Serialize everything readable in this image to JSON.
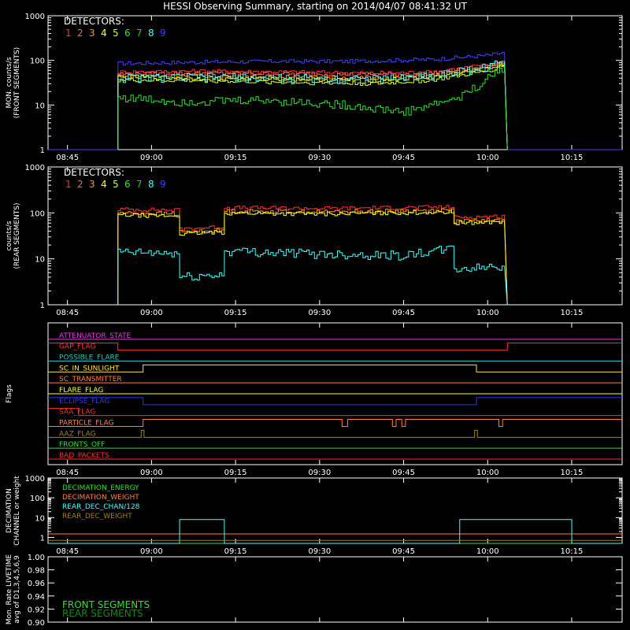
{
  "title": "HESSI Observing Summary, starting on 2014/04/07 08:41:32 UT",
  "colors": {
    "background": "#000000",
    "axes": "#ffffff",
    "det": [
      "#ff3030",
      "#ff6060",
      "#ff9020",
      "#ffff20",
      "#c8ff20",
      "#30e030",
      "#30c030",
      "#40ffff",
      "#4040ff"
    ]
  },
  "time_ticks": [
    "08:45",
    "09:00",
    "09:15",
    "09:30",
    "09:45",
    "10:00",
    "10:15"
  ],
  "chart_data": [
    {
      "id": "front",
      "type": "line",
      "ylabel": "MON. counts/s\n(FRONT SEGMENTS)",
      "yscale": "log",
      "ylim": [
        1,
        1000
      ],
      "ytick_labels": [
        "1",
        "10",
        "100",
        "1000"
      ],
      "xlim": [
        "08:41:32",
        "10:24:00"
      ],
      "legend_title": "DETECTORS:",
      "legend_numbers": [
        "1",
        "2",
        "3",
        "4",
        "5",
        "6",
        "7",
        "8",
        "9"
      ],
      "series": [
        {
          "det": 9,
          "x": [
            "08:41:32",
            "08:54:00",
            "08:54:01",
            "09:05",
            "09:20",
            "09:35",
            "09:50",
            "10:00",
            "10:03",
            "10:03:30",
            "10:24"
          ],
          "y": [
            1,
            1,
            85,
            90,
            95,
            95,
            105,
            130,
            150,
            1,
            1
          ]
        },
        {
          "det": 1,
          "x": [
            "08:54:00",
            "08:54:01",
            "09:10",
            "09:25",
            "09:40",
            "09:50",
            "10:00",
            "10:03",
            "10:03:30"
          ],
          "y": [
            1,
            55,
            58,
            55,
            52,
            55,
            80,
            100,
            1
          ]
        },
        {
          "det": 2,
          "x": [
            "08:54:00",
            "08:54:01",
            "09:10",
            "09:25",
            "09:40",
            "09:50",
            "10:00",
            "10:03",
            "10:03:30"
          ],
          "y": [
            1,
            50,
            52,
            50,
            48,
            52,
            75,
            95,
            1
          ]
        },
        {
          "det": 3,
          "x": [
            "08:54:00",
            "08:54:01",
            "09:10",
            "09:25",
            "09:40",
            "09:50",
            "10:00",
            "10:03",
            "10:03:30"
          ],
          "y": [
            1,
            45,
            45,
            42,
            40,
            45,
            70,
            90,
            1
          ]
        },
        {
          "det": 4,
          "x": [
            "08:54:00",
            "08:54:01",
            "09:10",
            "09:25",
            "09:40",
            "09:50",
            "10:00",
            "10:03",
            "10:03:30"
          ],
          "y": [
            1,
            42,
            40,
            38,
            36,
            42,
            65,
            85,
            1
          ]
        },
        {
          "det": 5,
          "x": [
            "08:54:00",
            "08:54:01",
            "09:10",
            "09:25",
            "09:40",
            "09:50",
            "10:00",
            "10:03",
            "10:03:30"
          ],
          "y": [
            1,
            36,
            35,
            32,
            30,
            36,
            58,
            80,
            1
          ]
        },
        {
          "det": 8,
          "x": [
            "08:54:00",
            "08:54:01",
            "09:10",
            "09:25",
            "09:40",
            "09:50",
            "10:00",
            "10:03",
            "10:03:30"
          ],
          "y": [
            1,
            40,
            42,
            40,
            38,
            45,
            72,
            95,
            1
          ]
        },
        {
          "det": 6,
          "x": [
            "08:54:00",
            "08:54:01",
            "09:05",
            "09:20",
            "09:35",
            "09:45",
            "09:55",
            "10:00",
            "10:03",
            "10:03:30"
          ],
          "y": [
            1,
            15,
            12,
            13,
            10,
            7,
            15,
            40,
            75,
            1
          ]
        }
      ]
    },
    {
      "id": "rear",
      "type": "line",
      "ylabel": "counts/s\n(REAR SEGMENTS)",
      "yscale": "log",
      "ylim": [
        1,
        1000
      ],
      "ytick_labels": [
        "1",
        "10",
        "100",
        "1000"
      ],
      "xlim": [
        "08:41:32",
        "10:24:00"
      ],
      "legend_title": "DETECTORS:",
      "legend_numbers": [
        "1",
        "2",
        "3",
        "4",
        "5",
        "6",
        "7",
        "8",
        "9"
      ],
      "series": [
        {
          "det": 1,
          "x": [
            "08:54:00",
            "08:54:01",
            "09:05",
            "09:05:01",
            "09:13",
            "09:13:01",
            "09:30",
            "09:54",
            "09:54:01",
            "10:03",
            "10:03:30"
          ],
          "y": [
            1,
            120,
            115,
            45,
            50,
            130,
            125,
            135,
            80,
            85,
            1
          ]
        },
        {
          "det": 3,
          "x": [
            "08:54:00",
            "08:54:01",
            "09:05",
            "09:05:01",
            "09:13",
            "09:13:01",
            "09:30",
            "09:54",
            "09:54:01",
            "10:03",
            "10:03:30"
          ],
          "y": [
            1,
            100,
            95,
            38,
            42,
            110,
            105,
            115,
            65,
            70,
            1
          ]
        },
        {
          "det": 4,
          "x": [
            "08:54:00",
            "08:54:01",
            "09:05",
            "09:05:01",
            "09:13",
            "09:13:01",
            "09:30",
            "09:54",
            "09:54:01",
            "10:03",
            "10:03:30"
          ],
          "y": [
            1,
            90,
            85,
            35,
            38,
            100,
            95,
            105,
            60,
            65,
            1
          ]
        },
        {
          "det": 8,
          "x": [
            "08:54:00",
            "08:54:01",
            "09:05",
            "09:05:01",
            "09:13",
            "09:13:01",
            "09:30",
            "09:45",
            "09:54",
            "09:54:01",
            "10:03",
            "10:03:30"
          ],
          "y": [
            1,
            14,
            13,
            4,
            4.5,
            15,
            13,
            12,
            17,
            6,
            7,
            1
          ]
        }
      ]
    },
    {
      "id": "flags",
      "type": "line",
      "ylabel": "Flags",
      "xlim": [
        "08:41:32",
        "10:24:00"
      ],
      "flags": [
        {
          "label": "ATTENUATOR_STATE",
          "color": "#e040e0",
          "steps": []
        },
        {
          "label": "GAP_FLAG",
          "color": "#ff3030",
          "steps": [
            [
              "08:41:32",
              1
            ],
            [
              "08:54:00",
              0
            ],
            [
              "10:03:30",
              1
            ]
          ]
        },
        {
          "label": "POSSIBLE_FLARE",
          "color": "#30c0c0",
          "steps": []
        },
        {
          "label": "SC_IN_SUNLIGHT",
          "color": "#ffe040",
          "steps": [
            [
              "08:41:32",
              0
            ],
            [
              "08:58:30",
              1
            ],
            [
              "09:58:00",
              0
            ]
          ]
        },
        {
          "label": "SC_TRANSMITTER",
          "color": "#ff8040",
          "steps": []
        },
        {
          "label": "FLARE_FLAG",
          "color": "#ffff20",
          "steps": []
        },
        {
          "label": "ECLIPSE_FLAG",
          "color": "#3030ff",
          "steps": [
            [
              "08:41:32",
              1
            ],
            [
              "08:58:30",
              0
            ],
            [
              "09:58:00",
              1
            ]
          ]
        },
        {
          "label": "SAA_FLAG",
          "color": "#ff3030",
          "steps": [
            [
              "08:41:32",
              1
            ],
            [
              "08:47:00",
              0
            ]
          ]
        },
        {
          "label": "PARTICLE_FLAG",
          "color": "#ff8040",
          "steps": [
            [
              "08:41:32",
              0
            ],
            [
              "08:58:30",
              1
            ],
            [
              "09:34:00",
              0
            ],
            [
              "09:35:00",
              1
            ],
            [
              "09:43:00",
              0
            ],
            [
              "09:43:40",
              1
            ],
            [
              "09:44:40",
              0
            ],
            [
              "09:45:20",
              1
            ],
            [
              "10:02:00",
              0
            ],
            [
              "10:02:40",
              1
            ]
          ]
        },
        {
          "label": "AAZ_FLAG",
          "color": "#a08020",
          "steps": [
            [
              "08:58:10",
              1
            ],
            [
              "08:58:40",
              0
            ],
            [
              "09:57:40",
              1
            ],
            [
              "09:58:10",
              0
            ]
          ]
        },
        {
          "label": "FRONTS_OFF",
          "color": "#30e030",
          "steps": []
        },
        {
          "label": "BAD_PACKETS",
          "color": "#ff3030",
          "steps": []
        }
      ]
    },
    {
      "id": "decimation",
      "type": "line",
      "ylabel": "DECIMATION\nCHANNEL or weight",
      "yscale": "log",
      "ylim": [
        0.5,
        1000
      ],
      "ytick_labels": [
        "1",
        "10",
        "100",
        "1000"
      ],
      "xlim": [
        "08:41:32",
        "10:24:00"
      ],
      "series": [
        {
          "name": "DECIMATION_ENERGY",
          "color": "#30e030",
          "x": [
            "08:41:32",
            "10:24:00"
          ],
          "y": [
            0.5,
            0.5
          ]
        },
        {
          "name": "DECIMATION_WEIGHT",
          "color": "#ff8040",
          "x": [
            "08:41:32",
            "10:24:00"
          ],
          "y": [
            1.5,
            1.5
          ]
        },
        {
          "name": "REAR_DEC_CHAN/128",
          "color": "#40ffff",
          "x": [
            "08:41:32",
            "09:05:00",
            "09:05:01",
            "09:13:00",
            "09:13:01",
            "09:55:00",
            "09:55:01",
            "10:15:00",
            "10:15:01",
            "10:24:00"
          ],
          "y": [
            0.5,
            0.5,
            8,
            8,
            0.5,
            0.5,
            8,
            8,
            0.5,
            0.5
          ]
        },
        {
          "name": "REAR_DEC_WEIGHT",
          "color": "#a08020",
          "x": [
            "08:41:32",
            "10:24:00"
          ],
          "y": [
            0.7,
            0.7
          ]
        }
      ]
    },
    {
      "id": "livetime",
      "type": "line",
      "ylabel": "Mon. Rate LIVETIME\navg of D1,3,4,5,6,9",
      "ylim": [
        0.9,
        1.0
      ],
      "ytick_labels": [
        "0.90",
        "0.92",
        "0.94",
        "0.96",
        "0.98",
        "1.00"
      ],
      "xlim": [
        "08:41:32",
        "10:24:00"
      ],
      "legend": [
        {
          "name": "FRONT SEGMENTS",
          "color": "#30e030"
        },
        {
          "name": "REAR SEGMENTS",
          "color": "#208020"
        }
      ]
    }
  ]
}
